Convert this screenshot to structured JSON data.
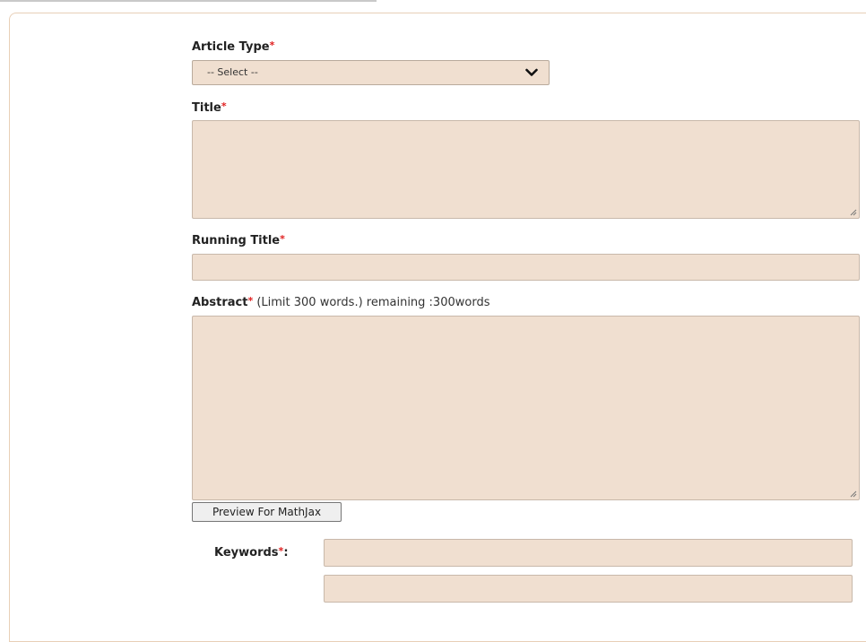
{
  "form": {
    "article_type": {
      "label": "Article Type",
      "required_mark": "*",
      "selected": "-- Select --"
    },
    "title": {
      "label": "Title",
      "required_mark": "*",
      "value": ""
    },
    "running_title": {
      "label": "Running Title",
      "required_mark": "*",
      "value": ""
    },
    "abstract": {
      "label": "Abstract",
      "required_mark": "*",
      "note": " (Limit 300 words.) remaining :300words",
      "value": ""
    },
    "preview_button": "Preview For MathJax",
    "keywords": {
      "label": "Keywords",
      "required_mark": "*",
      "suffix": ":",
      "values": [
        "",
        ""
      ]
    }
  },
  "colors": {
    "field_bg": "#f0dfd0",
    "panel_border": "#e8cfb7",
    "required": "#e02020"
  }
}
